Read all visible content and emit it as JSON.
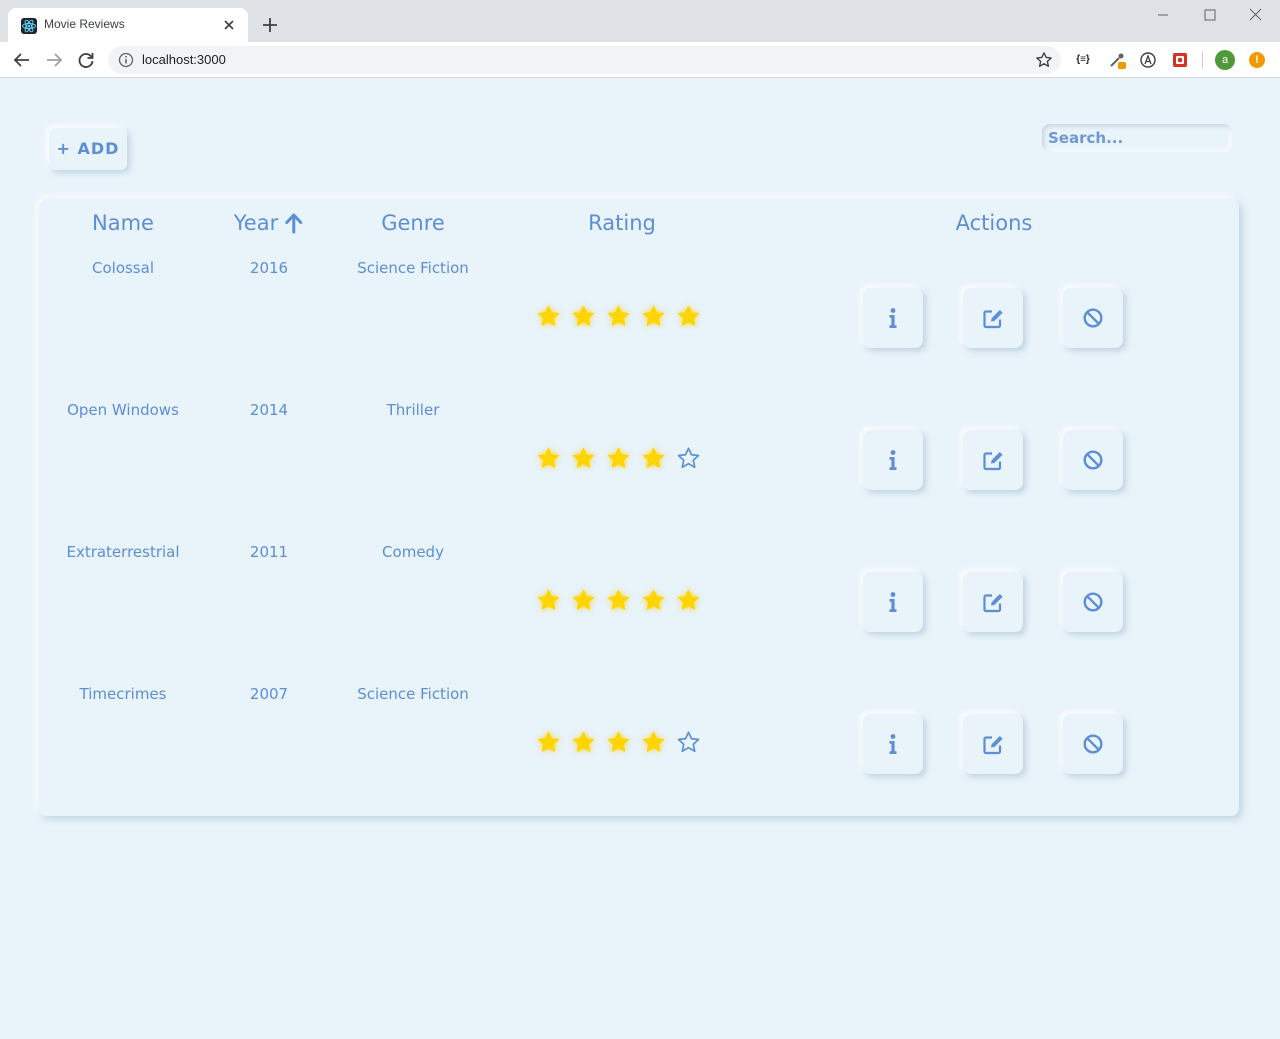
{
  "browser": {
    "tab_title": "Movie Reviews",
    "url": "localhost:3000",
    "avatar_letter": "a",
    "alert_symbol": "!",
    "ext_json_label": "{≡}"
  },
  "toolbar": {
    "add_label": "+ ADD",
    "search_placeholder": "Search..."
  },
  "table": {
    "headers": {
      "name": "Name",
      "year": "Year",
      "genre": "Genre",
      "rating": "Rating",
      "actions": "Actions"
    },
    "sort": {
      "column": "year",
      "icon": "arrow-up-icon"
    },
    "rows": [
      {
        "name": "Colossal",
        "year": "2016",
        "genre": "Science Fiction",
        "rating": 5
      },
      {
        "name": "Open Windows",
        "year": "2014",
        "genre": "Thriller",
        "rating": 4
      },
      {
        "name": "Extraterrestrial",
        "year": "2011",
        "genre": "Comedy",
        "rating": 5
      },
      {
        "name": "Timecrimes",
        "year": "2007",
        "genre": "Science Fiction",
        "rating": 4
      }
    ],
    "max_rating": 5,
    "action_icons": [
      "info-icon",
      "edit-icon",
      "ban-icon"
    ]
  },
  "colors": {
    "accent": "#5d8ed6",
    "background": "#e8f3fa",
    "star": "#ffd500"
  }
}
